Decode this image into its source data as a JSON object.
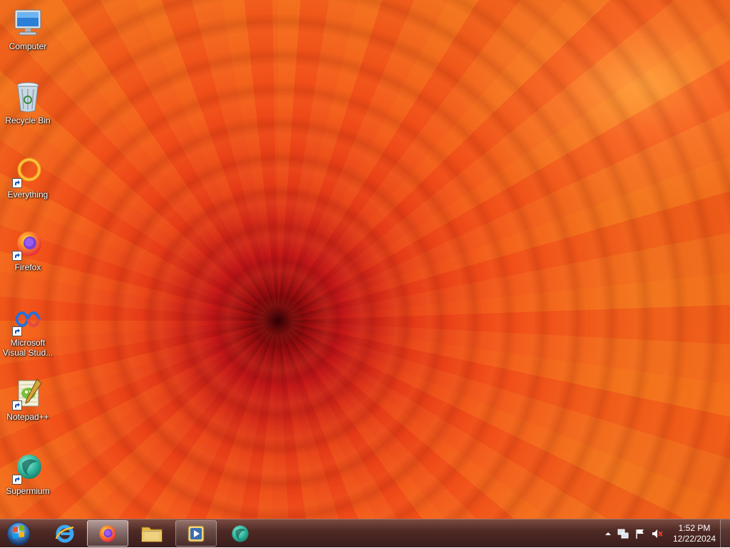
{
  "desktop": {
    "icons": [
      {
        "label": "Computer",
        "icon": "computer-icon",
        "shortcut": false
      },
      {
        "label": "Recycle Bin",
        "icon": "recycle-bin-icon",
        "shortcut": false
      },
      {
        "label": "Everything",
        "icon": "everything-icon",
        "shortcut": true
      },
      {
        "label": "Firefox",
        "icon": "firefox-icon",
        "shortcut": true
      },
      {
        "label": "Microsoft Visual Stud...",
        "icon": "visual-studio-icon",
        "shortcut": true
      },
      {
        "label": "Notepad++",
        "icon": "notepad-plus-plus-icon",
        "shortcut": true
      },
      {
        "label": "Supermium",
        "icon": "supermium-icon",
        "shortcut": true
      }
    ]
  },
  "taskbar": {
    "start": "windows-start-icon",
    "pinned": [
      {
        "icon": "internet-explorer-icon",
        "state": "pinned"
      },
      {
        "icon": "firefox-icon",
        "state": "active"
      },
      {
        "icon": "file-explorer-icon",
        "state": "pinned"
      },
      {
        "icon": "media-player-icon",
        "state": "running"
      },
      {
        "icon": "supermium-icon",
        "state": "pinned"
      }
    ],
    "tray": {
      "icons": [
        "show-hidden-icons-chevron-icon",
        "network-icon",
        "action-center-flag-icon",
        "volume-muted-icon"
      ],
      "time": "1:52 PM",
      "date": "12/22/2024"
    }
  },
  "colors": {
    "taskbar": "#4a1c16",
    "label_text": "#ffffff"
  }
}
